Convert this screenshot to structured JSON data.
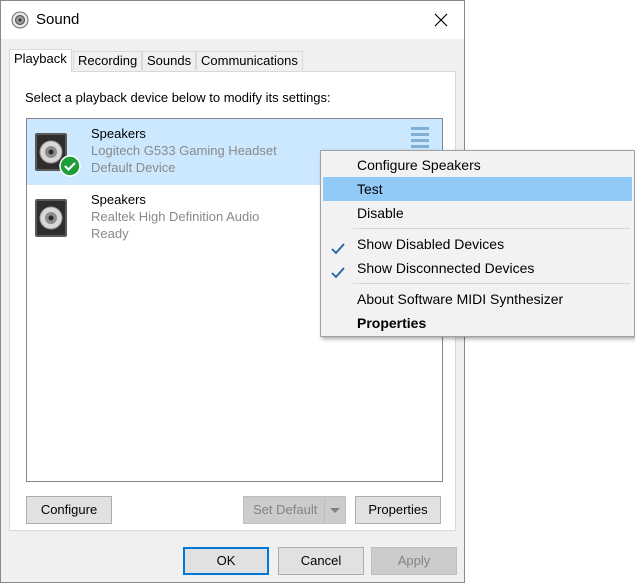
{
  "window": {
    "title": "Sound",
    "app_icon": "speaker-icon",
    "close_icon": "close-icon"
  },
  "tabs": [
    {
      "label": "Playback",
      "active": true
    },
    {
      "label": "Recording",
      "active": false
    },
    {
      "label": "Sounds",
      "active": false
    },
    {
      "label": "Communications",
      "active": false
    }
  ],
  "playback": {
    "instruction": "Select a playback device below to modify its settings:",
    "devices": [
      {
        "name": "Speakers",
        "description": "Logitech G533 Gaming Headset",
        "status": "Default Device",
        "selected": true,
        "badge": "checkmark-badge-icon"
      },
      {
        "name": "Speakers",
        "description": "Realtek High Definition Audio",
        "status": "Ready",
        "selected": false
      }
    ],
    "buttons": {
      "configure": "Configure",
      "set_default": "Set Default",
      "properties": "Properties"
    }
  },
  "footer": {
    "ok": "OK",
    "cancel": "Cancel",
    "apply": "Apply"
  },
  "context_menu": {
    "items": [
      {
        "label": "Configure Speakers"
      },
      {
        "label": "Test",
        "highlighted": true
      },
      {
        "label": "Disable"
      },
      {
        "label": "Show Disabled Devices",
        "checked": true
      },
      {
        "label": "Show Disconnected Devices",
        "checked": true
      },
      {
        "label": "About Software MIDI Synthesizer"
      },
      {
        "label": "Properties",
        "bold": true
      }
    ]
  },
  "colors": {
    "selection": "#cce8ff",
    "menu_highlight": "#91c9f7",
    "accent": "#0078d7",
    "badge_green": "#1e9e3a"
  }
}
